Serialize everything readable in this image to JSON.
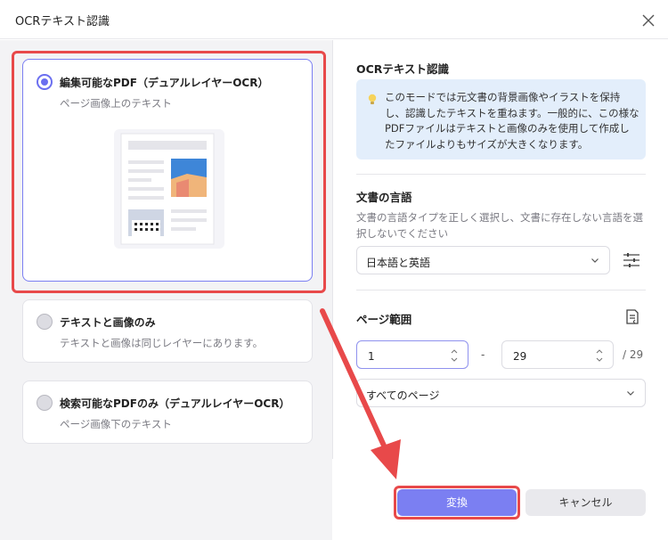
{
  "dialog": {
    "title": "OCRテキスト認識"
  },
  "options": [
    {
      "title": "編集可能なPDF（デュアルレイヤーOCR）",
      "desc": "ページ画像上のテキスト",
      "selected": true
    },
    {
      "title": "テキストと画像のみ",
      "desc": "テキストと画像は同じレイヤーにあります。",
      "selected": false
    },
    {
      "title": "検索可能なPDFのみ（デュアルレイヤーOCR）",
      "desc": "ページ画像下のテキスト",
      "selected": false
    }
  ],
  "ocr_section": {
    "title": "OCRテキスト認識",
    "info": "このモードでは元文書の背景画像やイラストを保持し、認識したテキストを重ねます。一般的に、この様なPDFファイルはテキストと画像のみを使用して作成したファイルよりもサイズが大きくなります。"
  },
  "language_section": {
    "title": "文書の言語",
    "help": "文書の言語タイプを正しく選択し、文書に存在しない言語を選択しないでください",
    "selected": "日本語と英語"
  },
  "page_range": {
    "title": "ページ範囲",
    "from": "1",
    "separator": "-",
    "to": "29",
    "total": "/ 29",
    "scope": "すべてのページ"
  },
  "buttons": {
    "convert": "変換",
    "cancel": "キャンセル"
  },
  "colors": {
    "accent": "#7b7ff2",
    "highlight": "#e8494a",
    "info_bg": "#e3eefb"
  }
}
